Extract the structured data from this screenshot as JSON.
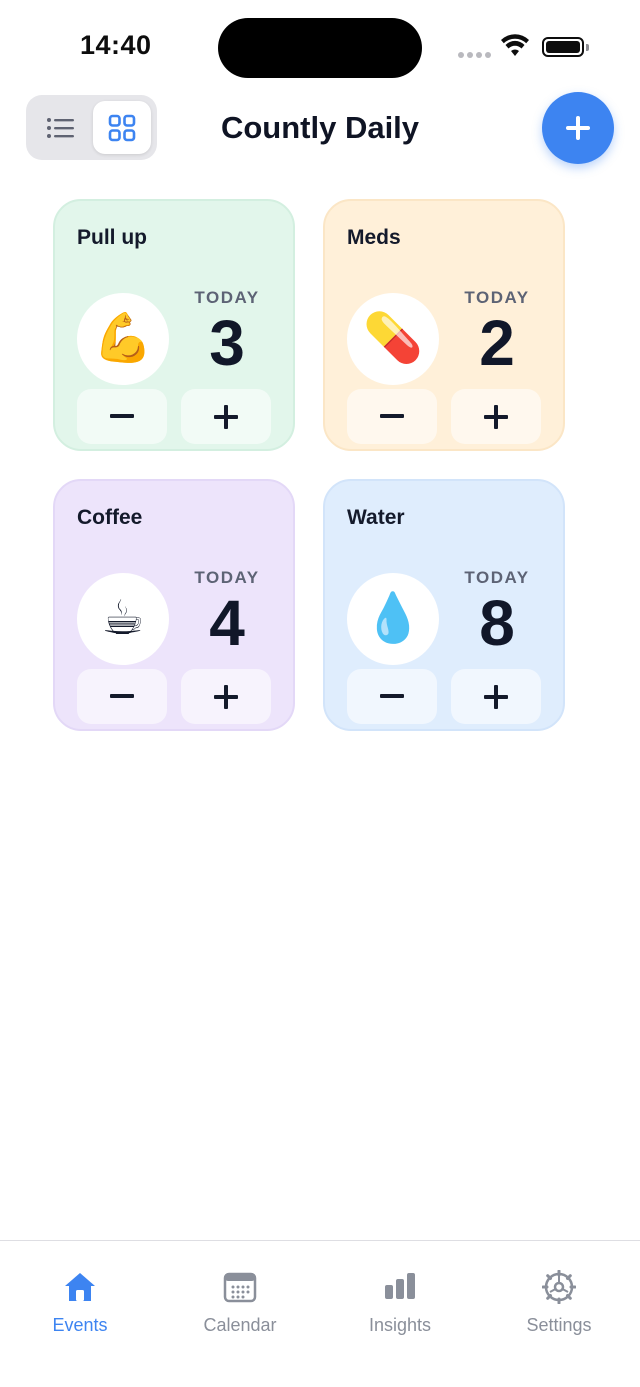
{
  "status_bar": {
    "time": "14:40"
  },
  "header": {
    "title": "Countly Daily"
  },
  "colors": {
    "accent": "#3d84f1",
    "card_green": "#e2f6eb",
    "card_orange": "#fff0d9",
    "card_purple": "#ede4fb",
    "card_blue": "#dfedfd"
  },
  "cards": [
    {
      "title": "Pull up",
      "emoji": "💪",
      "period_label": "TODAY",
      "count": "3",
      "minus": "−",
      "plus": "+"
    },
    {
      "title": "Meds",
      "emoji": "💊",
      "period_label": "TODAY",
      "count": "2",
      "minus": "−",
      "plus": "+"
    },
    {
      "title": "Coffee",
      "emoji": "☕",
      "period_label": "TODAY",
      "count": "4",
      "minus": "−",
      "plus": "+"
    },
    {
      "title": "Water",
      "emoji": "💧",
      "period_label": "TODAY",
      "count": "8",
      "minus": "−",
      "plus": "+"
    }
  ],
  "tabs": [
    {
      "label": "Events",
      "icon": "house-icon",
      "active": true
    },
    {
      "label": "Calendar",
      "icon": "calendar-icon",
      "active": false
    },
    {
      "label": "Insights",
      "icon": "bar-chart-icon",
      "active": false
    },
    {
      "label": "Settings",
      "icon": "gear-icon",
      "active": false
    }
  ]
}
